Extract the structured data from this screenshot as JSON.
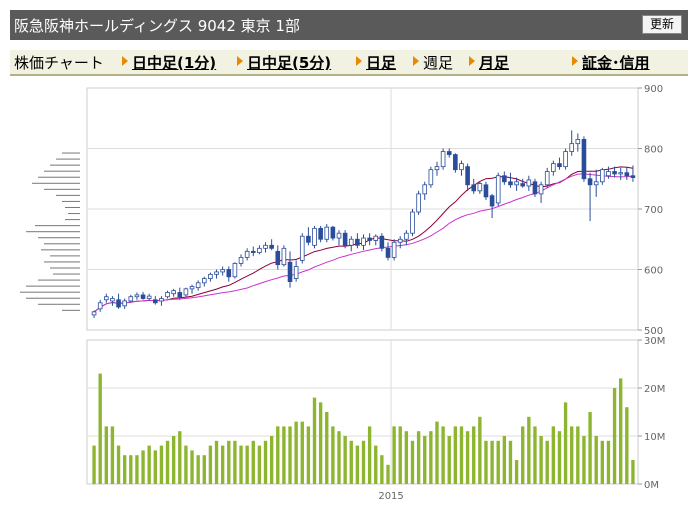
{
  "header": {
    "title": "阪急阪神ホールディングス 9042 東京 1部",
    "refresh_label": "更新"
  },
  "nav": {
    "chart_label": "株価チャート",
    "items": [
      {
        "label": "日中足(1分)",
        "link": true
      },
      {
        "label": "日中足(5分)",
        "link": true
      },
      {
        "label": "日足",
        "link": true
      },
      {
        "label": "週足",
        "link": false
      },
      {
        "label": "月足",
        "link": true
      },
      {
        "label": "証金･信用",
        "link": true
      }
    ]
  },
  "colors": {
    "up": "#2a4d9a",
    "down": "#ffffff",
    "ma_short": "#8b0035",
    "ma_long": "#cc33cc",
    "volume": "#8db530",
    "histogram": "#7a7a7a"
  },
  "chart_data": {
    "type": "candlestick",
    "price_axis": {
      "ticks": [
        500,
        600,
        700,
        800,
        900
      ],
      "labels": [
        "500",
        "600",
        "700",
        "800",
        "900"
      ],
      "ylim": [
        500,
        900
      ]
    },
    "volume_axis": {
      "ticks": [
        0,
        10,
        20,
        30
      ],
      "labels": [
        "0M",
        "10M",
        "20M",
        "30M"
      ],
      "ylim": [
        0,
        30
      ]
    },
    "x_labels": [
      {
        "index": 49,
        "label": "2015"
      }
    ],
    "volume": [
      8,
      23,
      12,
      12,
      8,
      6,
      6,
      6,
      7,
      8,
      7,
      8,
      9,
      10,
      11,
      8,
      7,
      6,
      6,
      8,
      9,
      8,
      9,
      9,
      8,
      8,
      9,
      8,
      9,
      10,
      12,
      12,
      12,
      13,
      13,
      12,
      18,
      17,
      15,
      12,
      11,
      10,
      9,
      8,
      9,
      12,
      8,
      6,
      4,
      12,
      12,
      11,
      9,
      11,
      10,
      11,
      13,
      12,
      10,
      12,
      12,
      11,
      12,
      14,
      9,
      9,
      9,
      10,
      9,
      5,
      12,
      14,
      12,
      10,
      9,
      12,
      11,
      17,
      12,
      12,
      10,
      15,
      10,
      9,
      9,
      20,
      22,
      16,
      5
    ],
    "candles": [
      {
        "o": 525,
        "h": 532,
        "l": 520,
        "c": 530
      },
      {
        "o": 535,
        "h": 550,
        "l": 530,
        "c": 545
      },
      {
        "o": 550,
        "h": 560,
        "l": 545,
        "c": 555
      },
      {
        "o": 548,
        "h": 556,
        "l": 540,
        "c": 552
      },
      {
        "o": 550,
        "h": 560,
        "l": 535,
        "c": 538
      },
      {
        "o": 540,
        "h": 552,
        "l": 535,
        "c": 548
      },
      {
        "o": 548,
        "h": 558,
        "l": 545,
        "c": 555
      },
      {
        "o": 555,
        "h": 562,
        "l": 550,
        "c": 558
      },
      {
        "o": 558,
        "h": 563,
        "l": 550,
        "c": 552
      },
      {
        "o": 552,
        "h": 560,
        "l": 548,
        "c": 556
      },
      {
        "o": 550,
        "h": 556,
        "l": 542,
        "c": 545
      },
      {
        "o": 548,
        "h": 556,
        "l": 540,
        "c": 552
      },
      {
        "o": 555,
        "h": 565,
        "l": 552,
        "c": 562
      },
      {
        "o": 560,
        "h": 568,
        "l": 555,
        "c": 565
      },
      {
        "o": 562,
        "h": 570,
        "l": 550,
        "c": 555
      },
      {
        "o": 558,
        "h": 570,
        "l": 555,
        "c": 568
      },
      {
        "o": 568,
        "h": 575,
        "l": 560,
        "c": 572
      },
      {
        "o": 570,
        "h": 582,
        "l": 565,
        "c": 578
      },
      {
        "o": 578,
        "h": 588,
        "l": 572,
        "c": 585
      },
      {
        "o": 585,
        "h": 595,
        "l": 580,
        "c": 592
      },
      {
        "o": 592,
        "h": 600,
        "l": 585,
        "c": 596
      },
      {
        "o": 596,
        "h": 605,
        "l": 590,
        "c": 600
      },
      {
        "o": 600,
        "h": 605,
        "l": 580,
        "c": 588
      },
      {
        "o": 588,
        "h": 612,
        "l": 585,
        "c": 610
      },
      {
        "o": 610,
        "h": 625,
        "l": 605,
        "c": 620
      },
      {
        "o": 620,
        "h": 635,
        "l": 615,
        "c": 630
      },
      {
        "o": 630,
        "h": 638,
        "l": 622,
        "c": 628
      },
      {
        "o": 628,
        "h": 640,
        "l": 625,
        "c": 635
      },
      {
        "o": 635,
        "h": 645,
        "l": 628,
        "c": 640
      },
      {
        "o": 640,
        "h": 650,
        "l": 632,
        "c": 635
      },
      {
        "o": 630,
        "h": 640,
        "l": 600,
        "c": 608
      },
      {
        "o": 608,
        "h": 640,
        "l": 605,
        "c": 635
      },
      {
        "o": 612,
        "h": 630,
        "l": 570,
        "c": 580
      },
      {
        "o": 585,
        "h": 615,
        "l": 580,
        "c": 605
      },
      {
        "o": 615,
        "h": 660,
        "l": 610,
        "c": 655
      },
      {
        "o": 655,
        "h": 670,
        "l": 640,
        "c": 645
      },
      {
        "o": 640,
        "h": 672,
        "l": 635,
        "c": 668
      },
      {
        "o": 668,
        "h": 672,
        "l": 645,
        "c": 650
      },
      {
        "o": 650,
        "h": 675,
        "l": 645,
        "c": 670
      },
      {
        "o": 670,
        "h": 672,
        "l": 648,
        "c": 652
      },
      {
        "o": 652,
        "h": 665,
        "l": 640,
        "c": 660
      },
      {
        "o": 660,
        "h": 665,
        "l": 635,
        "c": 640
      },
      {
        "o": 640,
        "h": 655,
        "l": 630,
        "c": 650
      },
      {
        "o": 650,
        "h": 660,
        "l": 635,
        "c": 640
      },
      {
        "o": 640,
        "h": 658,
        "l": 632,
        "c": 652
      },
      {
        "o": 652,
        "h": 660,
        "l": 640,
        "c": 648
      },
      {
        "o": 648,
        "h": 658,
        "l": 640,
        "c": 655
      },
      {
        "o": 655,
        "h": 660,
        "l": 630,
        "c": 635
      },
      {
        "o": 635,
        "h": 645,
        "l": 615,
        "c": 620
      },
      {
        "o": 620,
        "h": 650,
        "l": 615,
        "c": 645
      },
      {
        "o": 645,
        "h": 655,
        "l": 635,
        "c": 650
      },
      {
        "o": 650,
        "h": 665,
        "l": 640,
        "c": 660
      },
      {
        "o": 660,
        "h": 700,
        "l": 655,
        "c": 695
      },
      {
        "o": 695,
        "h": 730,
        "l": 690,
        "c": 725
      },
      {
        "o": 725,
        "h": 745,
        "l": 715,
        "c": 740
      },
      {
        "o": 740,
        "h": 770,
        "l": 735,
        "c": 765
      },
      {
        "o": 765,
        "h": 778,
        "l": 755,
        "c": 770
      },
      {
        "o": 770,
        "h": 800,
        "l": 765,
        "c": 795
      },
      {
        "o": 795,
        "h": 800,
        "l": 785,
        "c": 790
      },
      {
        "o": 790,
        "h": 792,
        "l": 760,
        "c": 765
      },
      {
        "o": 765,
        "h": 780,
        "l": 755,
        "c": 775
      },
      {
        "o": 770,
        "h": 775,
        "l": 730,
        "c": 740
      },
      {
        "o": 740,
        "h": 750,
        "l": 725,
        "c": 730
      },
      {
        "o": 730,
        "h": 745,
        "l": 725,
        "c": 742
      },
      {
        "o": 740,
        "h": 745,
        "l": 715,
        "c": 720
      },
      {
        "o": 722,
        "h": 725,
        "l": 685,
        "c": 705
      },
      {
        "o": 710,
        "h": 760,
        "l": 705,
        "c": 755
      },
      {
        "o": 755,
        "h": 762,
        "l": 740,
        "c": 745
      },
      {
        "o": 745,
        "h": 760,
        "l": 735,
        "c": 740
      },
      {
        "o": 740,
        "h": 752,
        "l": 730,
        "c": 745
      },
      {
        "o": 742,
        "h": 750,
        "l": 735,
        "c": 738
      },
      {
        "o": 738,
        "h": 755,
        "l": 730,
        "c": 748
      },
      {
        "o": 745,
        "h": 750,
        "l": 720,
        "c": 725
      },
      {
        "o": 725,
        "h": 745,
        "l": 710,
        "c": 740
      },
      {
        "o": 740,
        "h": 768,
        "l": 735,
        "c": 762
      },
      {
        "o": 762,
        "h": 780,
        "l": 755,
        "c": 775
      },
      {
        "o": 775,
        "h": 785,
        "l": 765,
        "c": 770
      },
      {
        "o": 770,
        "h": 800,
        "l": 765,
        "c": 795
      },
      {
        "o": 795,
        "h": 830,
        "l": 788,
        "c": 808
      },
      {
        "o": 808,
        "h": 825,
        "l": 795,
        "c": 815
      },
      {
        "o": 815,
        "h": 820,
        "l": 745,
        "c": 750
      },
      {
        "o": 750,
        "h": 760,
        "l": 680,
        "c": 740
      },
      {
        "o": 740,
        "h": 765,
        "l": 720,
        "c": 745
      },
      {
        "o": 745,
        "h": 768,
        "l": 740,
        "c": 765
      },
      {
        "o": 755,
        "h": 770,
        "l": 750,
        "c": 762
      },
      {
        "o": 762,
        "h": 770,
        "l": 752,
        "c": 758
      },
      {
        "o": 758,
        "h": 768,
        "l": 748,
        "c": 760
      },
      {
        "o": 760,
        "h": 770,
        "l": 748,
        "c": 755
      },
      {
        "o": 755,
        "h": 772,
        "l": 745,
        "c": 752
      }
    ],
    "volume_by_price": [
      {
        "price": 790,
        "len": 6
      },
      {
        "price": 780,
        "len": 8
      },
      {
        "price": 770,
        "len": 10
      },
      {
        "price": 760,
        "len": 12
      },
      {
        "price": 750,
        "len": 14
      },
      {
        "price": 740,
        "len": 16
      },
      {
        "price": 730,
        "len": 12
      },
      {
        "price": 720,
        "len": 8
      },
      {
        "price": 710,
        "len": 6
      },
      {
        "price": 700,
        "len": 5
      },
      {
        "price": 690,
        "len": 4
      },
      {
        "price": 680,
        "len": 5
      },
      {
        "price": 670,
        "len": 15
      },
      {
        "price": 660,
        "len": 18
      },
      {
        "price": 650,
        "len": 14
      },
      {
        "price": 640,
        "len": 12
      },
      {
        "price": 630,
        "len": 13
      },
      {
        "price": 620,
        "len": 10
      },
      {
        "price": 610,
        "len": 12
      },
      {
        "price": 600,
        "len": 10
      },
      {
        "price": 590,
        "len": 9
      },
      {
        "price": 580,
        "len": 14
      },
      {
        "price": 570,
        "len": 18
      },
      {
        "price": 560,
        "len": 20
      },
      {
        "price": 550,
        "len": 18
      },
      {
        "price": 540,
        "len": 14
      },
      {
        "price": 530,
        "len": 6
      }
    ]
  }
}
